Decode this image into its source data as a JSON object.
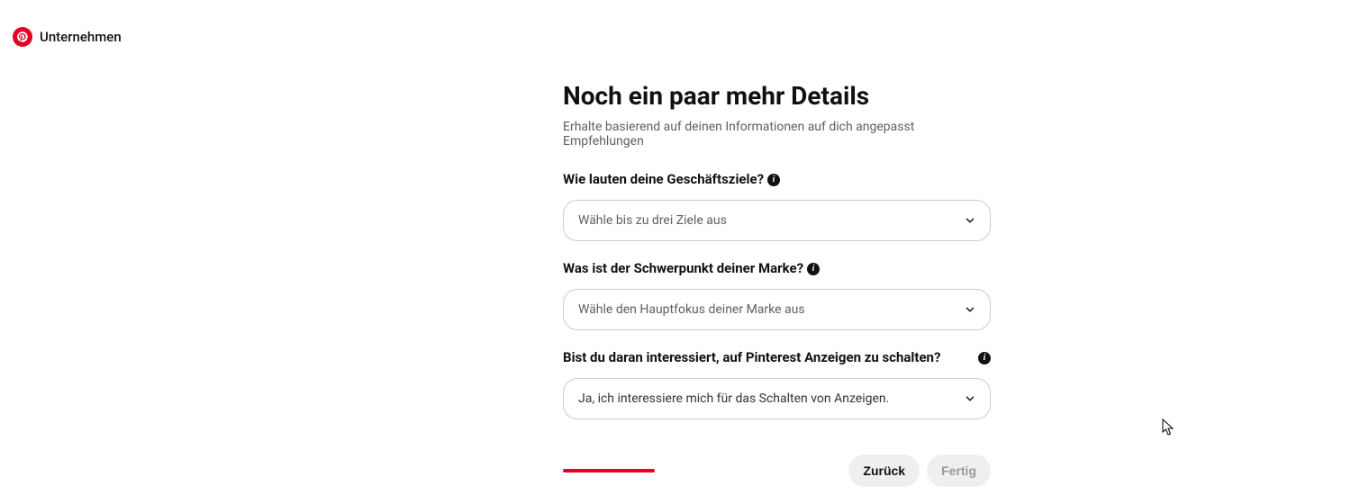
{
  "header": {
    "brand": "Unternehmen"
  },
  "main": {
    "title": "Noch ein paar mehr Details",
    "subtitle": "Erhalte basierend auf deinen Informationen auf dich angepasst Empfehlungen",
    "q1": {
      "label": "Wie lauten deine Geschäftsziele?",
      "placeholder": "Wähle bis zu drei Ziele aus"
    },
    "q2": {
      "label": "Was ist der Schwerpunkt deiner Marke?",
      "placeholder": "Wähle den Hauptfokus deiner Marke aus"
    },
    "q3": {
      "label": "Bist du daran interessiert, auf Pinterest Anzeigen zu schalten?",
      "value": "Ja, ich interessiere mich für das Schalten von Anzeigen."
    }
  },
  "footer": {
    "back": "Zurück",
    "done": "Fertig"
  }
}
